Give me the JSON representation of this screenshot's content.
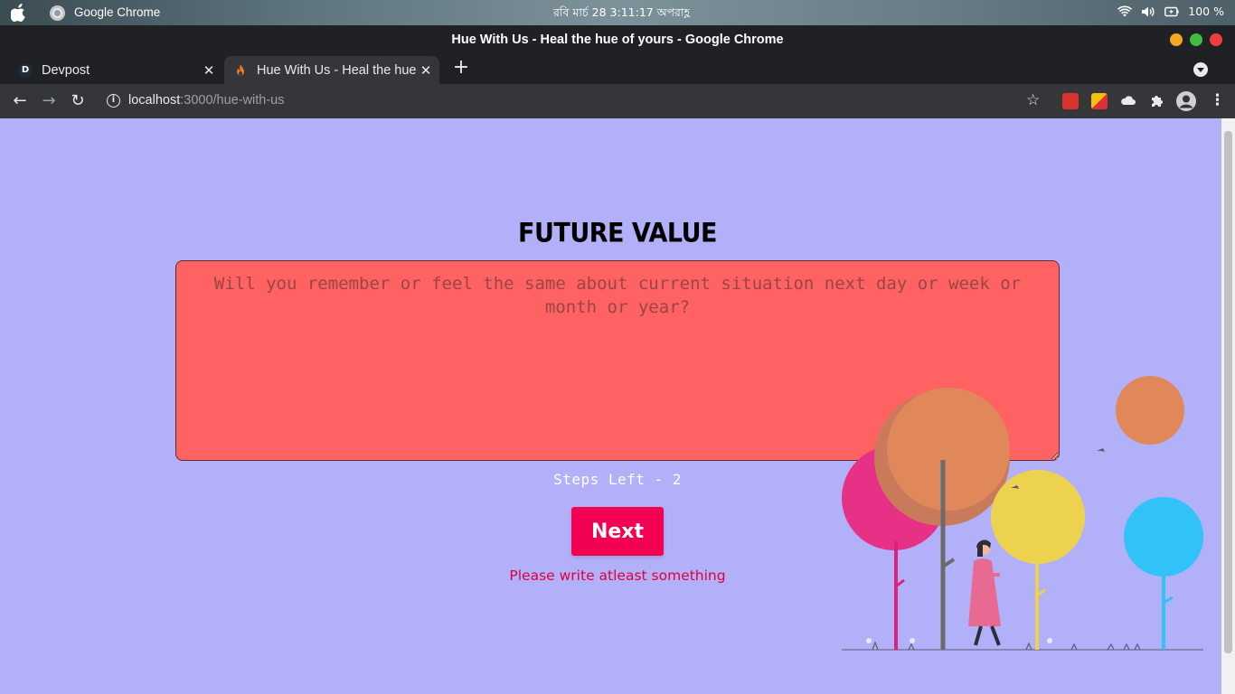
{
  "os": {
    "app_name": "Google Chrome",
    "clock": "রবি মার্চ 28   3:11:17 অপরাহ্ণ",
    "battery": "100 %"
  },
  "window": {
    "title": "Hue With Us - Heal the hue of yours - Google Chrome"
  },
  "tabs": [
    {
      "title": "Devpost",
      "favicon": "D"
    },
    {
      "title": "Hue With Us - Heal the hue of yours",
      "favicon": "flame-icon"
    }
  ],
  "address_bar": {
    "host": "localhost",
    "path": ":3000/hue-with-us"
  },
  "page": {
    "heading": "FUTURE VALUE",
    "textarea_placeholder": "Will you remember or feel the same about current situation next day or week or month or year?",
    "steps_left": "Steps Left - 2",
    "next_label": "Next",
    "error_message": "Please write atleast something"
  },
  "colors": {
    "background": "#b3b0fa",
    "textarea_bg": "#ff6262",
    "button_bg": "#f30254",
    "error_text": "#e0003a"
  }
}
